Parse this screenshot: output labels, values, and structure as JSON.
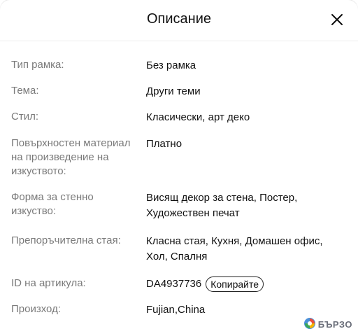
{
  "header": {
    "title": "Описание",
    "close_icon": "close-icon"
  },
  "rows": [
    {
      "label": "Тип рамка:",
      "value": "Без рамка"
    },
    {
      "label": "Тема:",
      "value": "Други теми"
    },
    {
      "label": "Стил:",
      "value": "Класически, арт деко"
    },
    {
      "label": "Повърхностен материал на произведение на изкуството:",
      "value": "Платно"
    },
    {
      "label": "Форма за стенно изкуство:",
      "value": "Висящ декор за стена, Постер, Художествен печат"
    },
    {
      "label": "Препоръчителна стая:",
      "value": "Класна стая, Кухня, Домашен офис, Хол, Спалня"
    },
    {
      "label": "ID на артикула:",
      "value": "DA4937736",
      "button": "Копирайте"
    },
    {
      "label": "Произход:",
      "value": "Fujian,China"
    }
  ],
  "watermark": {
    "text": "БЪРЗО",
    "color": "#6b6f7a"
  }
}
